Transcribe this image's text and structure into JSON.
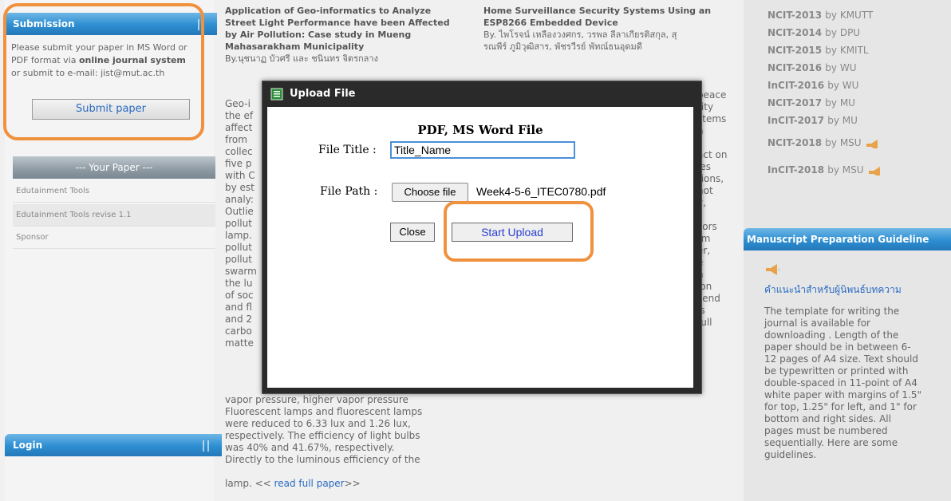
{
  "left": {
    "submission_title": "Submission",
    "submission_line1": "Please submit your paper in MS Word or",
    "submission_line2a": "PDF format via ",
    "submission_line2b": "online journal system",
    "submission_line3": "or submit to e-mail: jist@mut.ac.th",
    "submit_button": "Submit paper",
    "your_paper_title": "--- Your Paper ---",
    "paper_items": [
      "Edutainment Tools",
      "Edutainment Tools revise 1.1",
      "Sponsor"
    ],
    "login_title": "Login"
  },
  "mid_left": {
    "title_lines": [
      "Application of Geo-informatics to Analyze",
      "Street Light Performance have been Affected",
      "by Air Pollution: Case study in Mueng",
      "Mahasarakham Municipality"
    ],
    "authors": "By.นุชนาฏ บัวศรี และ ชนินทร จิตรกลาง",
    "abstract_lines": [
      "Geo-i",
      "the ef",
      "affect",
      "from",
      "collec",
      "five p",
      "with C",
      "by est",
      "analy:",
      "Outlie",
      "pollut",
      "lamp.",
      "pollut",
      "pollut",
      "swarm",
      "the lu",
      "of soc",
      "and fl",
      "and 2",
      "carbo",
      "matte"
    ],
    "tail_lines": [
      "vapor pressure, higher vapor pressure",
      "Fluorescent lamps and fluorescent lamps",
      "were reduced to 6.33 lux and 1.26 lux,",
      "respectively. The efficiency of light bulbs",
      "was 40% and 41.67%, respectively.",
      "Directly to the luminous efficiency of the"
    ],
    "last_line_prefix": "lamp. << ",
    "read_full": "read full paper",
    "last_line_suffix": ">>"
  },
  "mid_right": {
    "title_lines": [
      "Home Surveillance Security Systems Using an",
      "ESP8266 Embedded Device"
    ],
    "authors_lines": [
      "By. ไพโรจน์ เหลืองวงศกร, วรพล ลีลาเกียรติสกุล, สุ",
      "รณพีร์ ภูมิวุฒิสาร, พัชรวีรย์ พัทณ์ธนอุดมดี"
    ],
    "right_fragments": [
      "peace",
      "rity",
      "stems",
      "n",
      "r",
      "act on",
      "ies",
      "tions,",
      "not",
      "y,",
      "s",
      "sors",
      "rm",
      "er,",
      "e",
      "n",
      "ion",
      "send",
      "is",
      "full"
    ]
  },
  "right": {
    "conferences": [
      {
        "name": "NCIT-2013",
        "host": "by KMUTT",
        "new": false
      },
      {
        "name": "NCIT-2014",
        "host": "by DPU",
        "new": false
      },
      {
        "name": "NCIT-2015",
        "host": "by KMITL",
        "new": false
      },
      {
        "name": "NCIT-2016",
        "host": "by WU",
        "new": false
      },
      {
        "name": "InCIT-2016",
        "host": "by WU",
        "new": false
      },
      {
        "name": "NCIT-2017",
        "host": "by MU",
        "new": false
      },
      {
        "name": "InCIT-2017",
        "host": "by MU",
        "new": false
      },
      {
        "name": "NCIT-2018",
        "host": "by MSU",
        "new": true
      },
      {
        "name": "InCIT-2018",
        "host": "by MSU",
        "new": true
      }
    ],
    "manuscript_title": "Manuscript Preparation Guideline",
    "thai_link": "คำแนะนำสำหรับผู้นิพนธ์บทความ",
    "guideline_lines": [
      "The template for writing the",
      "journal is available for",
      "downloading . Length of the",
      "paper should be in between 6-",
      "12 pages of A4 size. Text should",
      "be typewritten or printed with",
      "double-spaced in 11-point of A4",
      "white paper with margins of 1.5\"",
      "for top, 1.25\" for left, and 1\" for",
      "bottom and right sides. All",
      "pages must be numbered",
      "sequentially. Here are some",
      "guidelines."
    ]
  },
  "modal": {
    "title": "Upload File",
    "heading": "PDF, MS Word File",
    "file_title_label": "File Title :",
    "file_title_value": "Title_Name",
    "file_path_label": "File Path :",
    "choose_button": "Choose file",
    "chosen_file": "Week4-5-6_ITEC0780.pdf",
    "close_button": "Close",
    "upload_button": "Start Upload"
  }
}
